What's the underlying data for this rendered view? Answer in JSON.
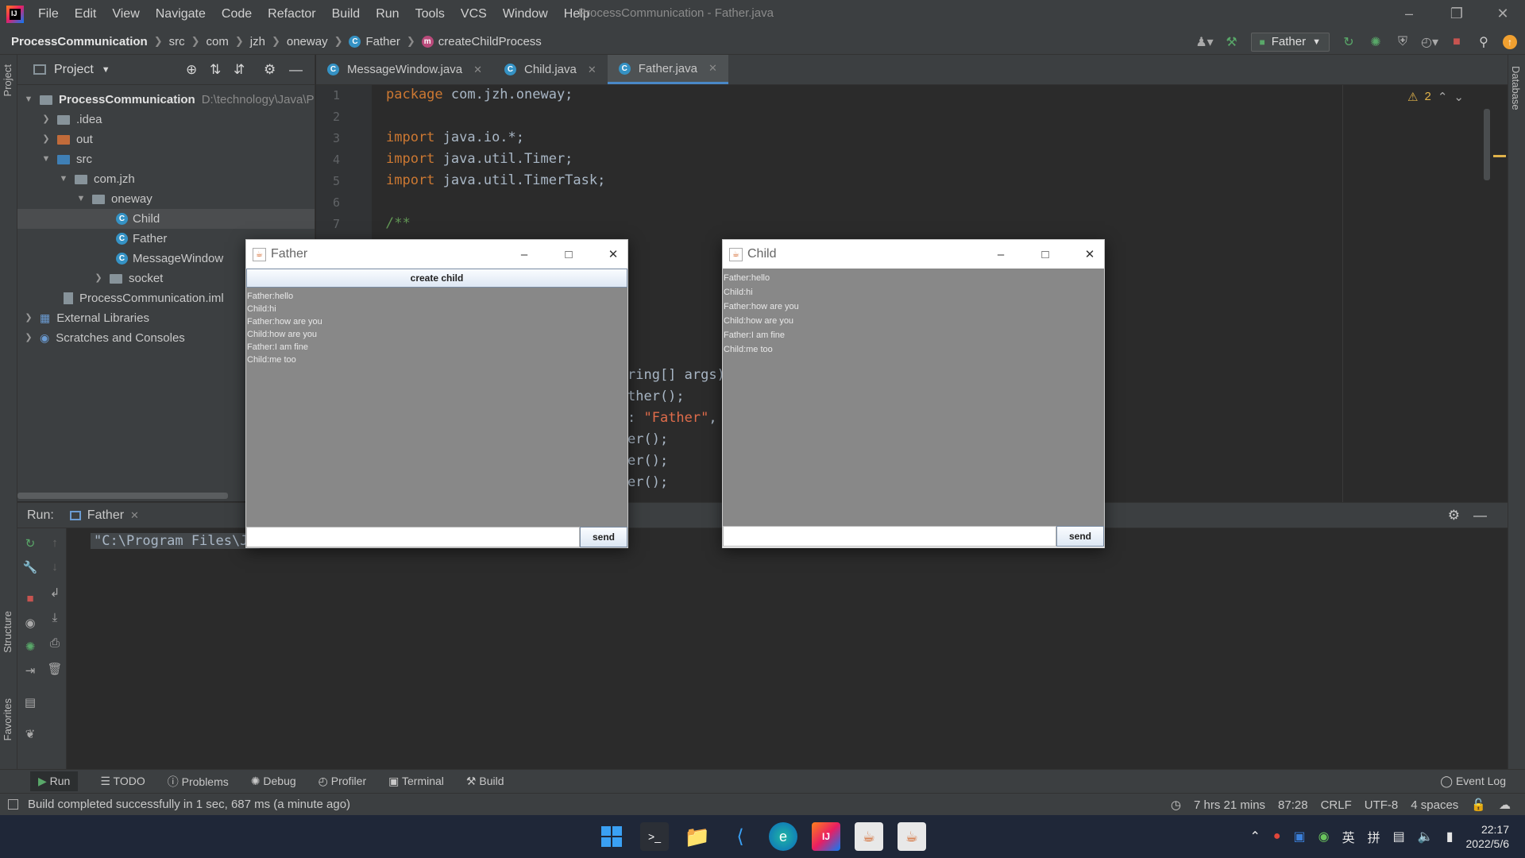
{
  "menubar": {
    "items": [
      "File",
      "Edit",
      "View",
      "Navigate",
      "Code",
      "Refactor",
      "Build",
      "Run",
      "Tools",
      "VCS",
      "Window",
      "Help"
    ],
    "window_title": "ProcessCommunication - Father.java"
  },
  "navbar": {
    "crumbs": [
      "ProcessCommunication",
      "src",
      "com",
      "jzh",
      "oneway",
      "Father",
      "createChildProcess"
    ],
    "run_config": "Father"
  },
  "project": {
    "header": "Project",
    "tree": [
      {
        "label": "ProcessCommunication",
        "path": "D:\\technology\\Java\\P"
      },
      {
        "label": ".idea"
      },
      {
        "label": "out"
      },
      {
        "label": "src"
      },
      {
        "label": "com.jzh"
      },
      {
        "label": "oneway"
      },
      {
        "label": "Child"
      },
      {
        "label": "Father"
      },
      {
        "label": "MessageWindow"
      },
      {
        "label": "socket"
      },
      {
        "label": "ProcessCommunication.iml"
      },
      {
        "label": "External Libraries"
      },
      {
        "label": "Scratches and Consoles"
      }
    ]
  },
  "left_stripe": {
    "project": "Project",
    "structure": "Structure",
    "favorites": "Favorites"
  },
  "right_stripe": {
    "database": "Database"
  },
  "editor": {
    "tabs": [
      "MessageWindow.java",
      "Child.java",
      "Father.java"
    ],
    "line_numbers": [
      "1",
      "2",
      "3",
      "4",
      "5",
      "6",
      "7"
    ],
    "lines": {
      "l1_kw": "package ",
      "l1_rest": "com.jzh.oneway;",
      "l3_kw": "import ",
      "l3_rest": "java.io.*;",
      "l4_kw": "import ",
      "l4_rest": "java.util.Timer;",
      "l5_kw": "import ",
      "l5_rest": "java.util.TimerTask;",
      "l7": "/**"
    },
    "partial": {
      "p1": "ring[] args)",
      "p2": "ther();",
      "p3_a": ": ",
      "p3_str": "\"Father\"",
      "p3_b": ",",
      "p4": "er();",
      "p5": "er();",
      "p6": "er();"
    },
    "warnings": "2"
  },
  "run": {
    "label": "Run:",
    "tab": "Father",
    "console": "\"C:\\Program Files\\Ja"
  },
  "father_window": {
    "title": "Father",
    "button": "create child",
    "messages": [
      "Father:hello",
      "Child:hi",
      "Father:how are you",
      "Child:how are you",
      "Father:I am fine",
      "Child:me too"
    ],
    "send": "send"
  },
  "child_window": {
    "title": "Child",
    "messages": [
      "Father:hello",
      "Child:hi",
      "Father:how are you",
      "Child:how are you",
      "Father:I am fine",
      "Child:me too"
    ],
    "send": "send"
  },
  "toolwindows": [
    "Run",
    "TODO",
    "Problems",
    "Debug",
    "Profiler",
    "Terminal",
    "Build",
    "Event Log"
  ],
  "status": {
    "message": "Build completed successfully in 1 sec, 687 ms (a minute ago)",
    "time_tracked": "7 hrs 21 mins",
    "position": "87:28",
    "line_sep": "CRLF",
    "encoding": "UTF-8",
    "indent": "4 spaces"
  },
  "taskbar": {
    "ime1": "英",
    "ime2": "拼",
    "time": "22:17",
    "date": "2022/5/6"
  },
  "colors": {
    "accent": "#4a88c7",
    "keyword": "#cc7832",
    "string": "#6a8759",
    "taskbar": "#1f2738"
  }
}
